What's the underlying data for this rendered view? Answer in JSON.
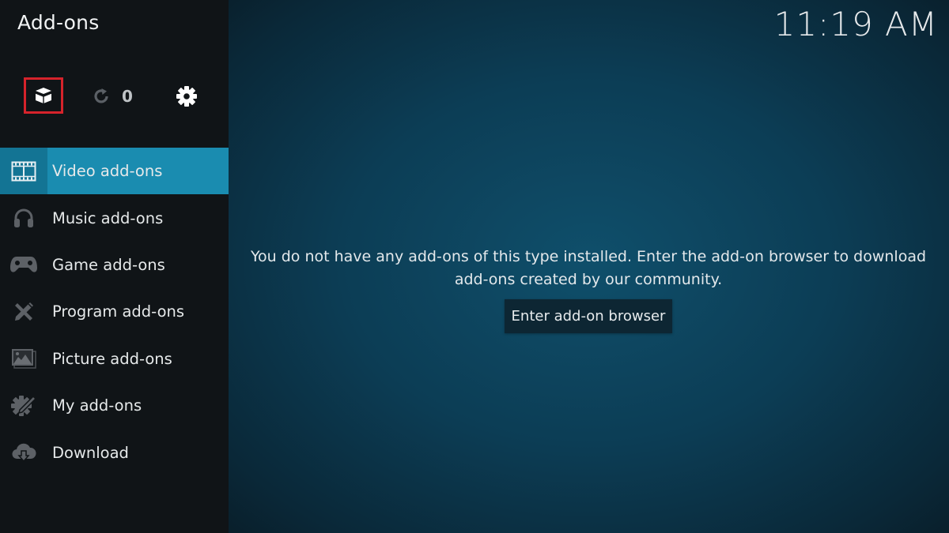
{
  "header": {
    "title": "Add-ons",
    "clock": "11:19 AM"
  },
  "toolbar": {
    "addon_browser_icon": "open-box-icon",
    "update_icon": "refresh-icon",
    "update_count": "0",
    "settings_icon": "gear-icon",
    "highlight_color": "#d6232b"
  },
  "sidebar": {
    "items": [
      {
        "label": "Video add-ons",
        "icon": "film-icon",
        "active": true
      },
      {
        "label": "Music add-ons",
        "icon": "headphones-icon",
        "active": false
      },
      {
        "label": "Game add-ons",
        "icon": "gamepad-icon",
        "active": false
      },
      {
        "label": "Program add-ons",
        "icon": "tools-icon",
        "active": false
      },
      {
        "label": "Picture add-ons",
        "icon": "picture-icon",
        "active": false
      },
      {
        "label": "My add-ons",
        "icon": "gear-wrench-icon",
        "active": false
      },
      {
        "label": "Download",
        "icon": "cloud-download-icon",
        "active": false
      }
    ],
    "active_color": "#1a8cb0"
  },
  "main": {
    "empty_message": "You do not have any add-ons of this type installed. Enter the add-on browser to download add-ons created by our community.",
    "browse_button": "Enter add-on browser"
  }
}
